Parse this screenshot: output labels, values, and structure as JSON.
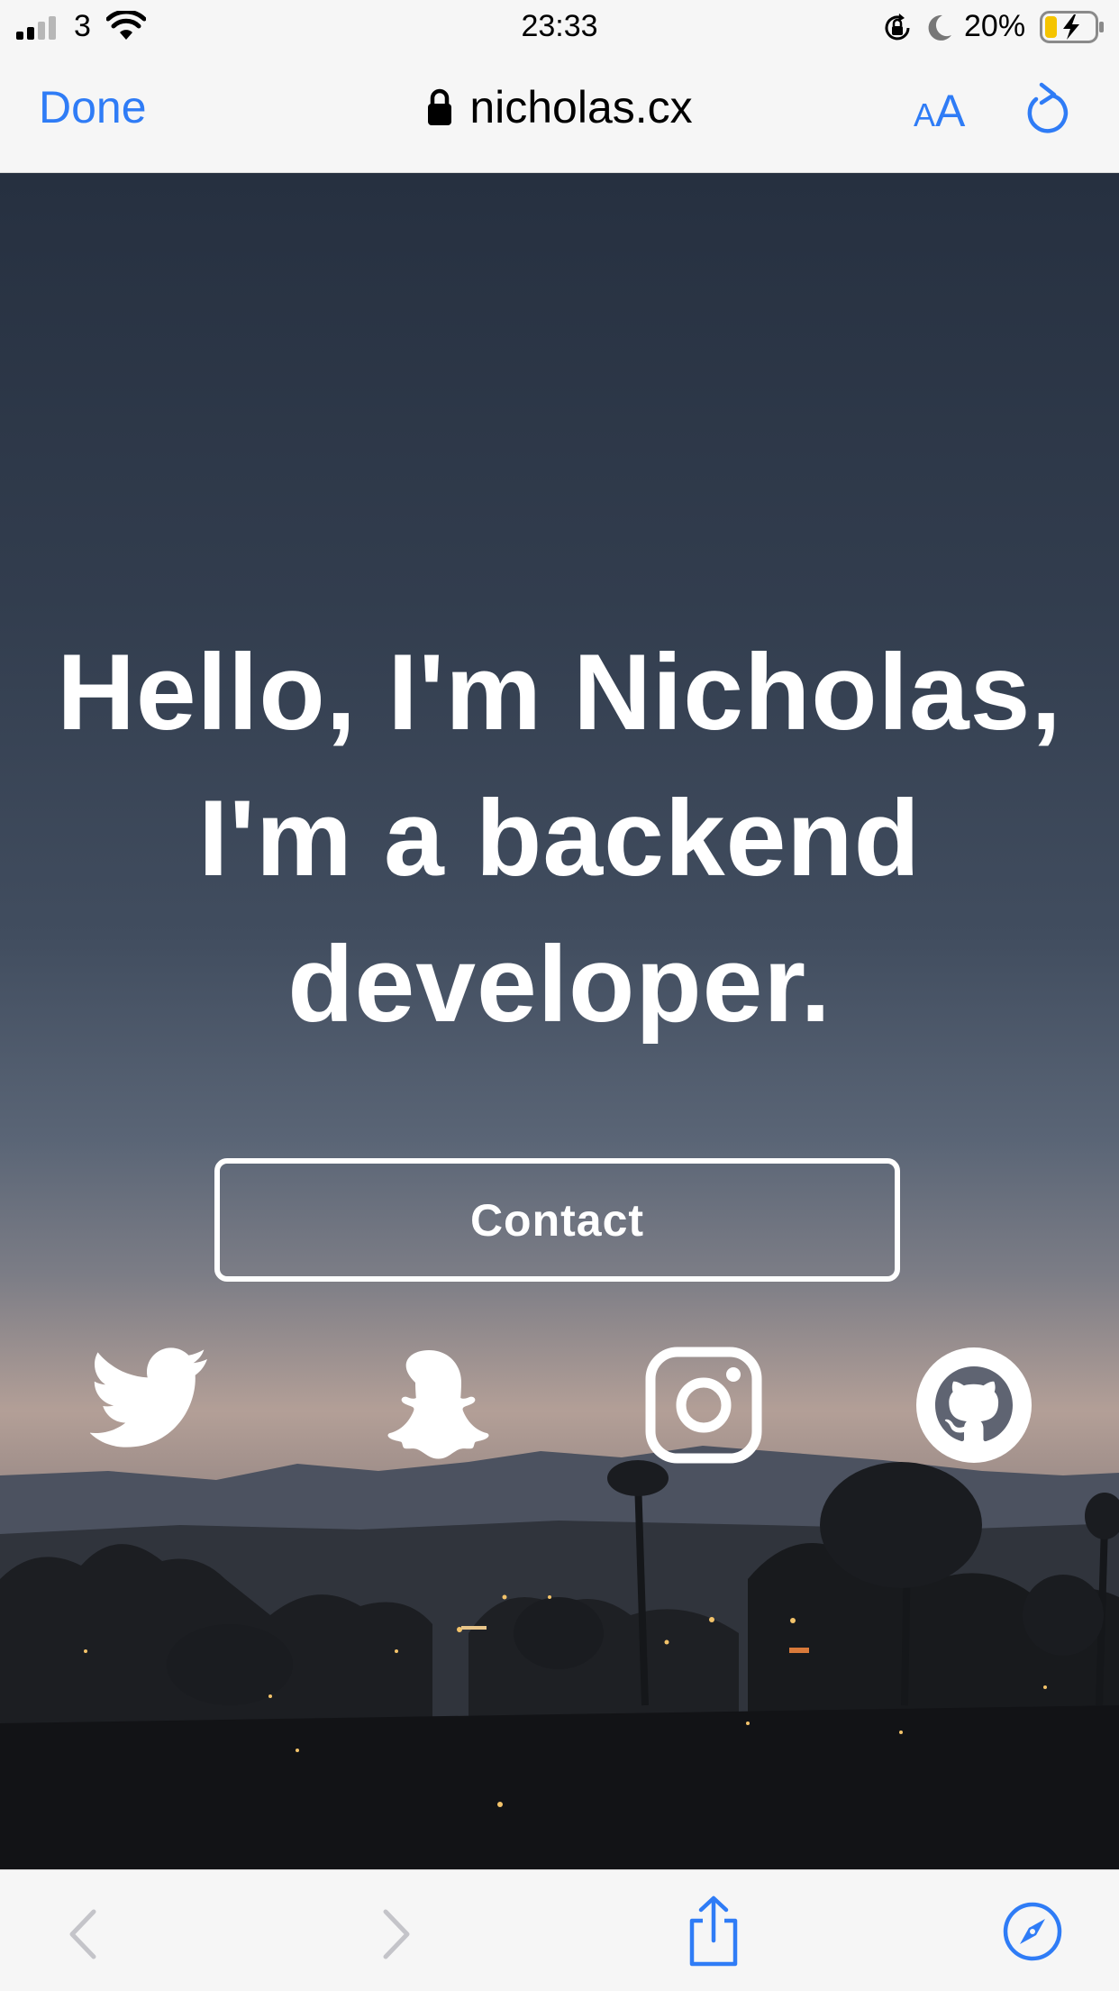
{
  "status_bar": {
    "carrier": "3",
    "time": "23:33",
    "battery_percent": "20%",
    "signal_bars": 2,
    "icons": [
      "signal-icon",
      "wifi-icon",
      "rotation-lock-icon",
      "moon-icon",
      "battery-charging-icon"
    ]
  },
  "nav": {
    "done_label": "Done",
    "url": "nicholas.cx",
    "text_size_label_small": "A",
    "text_size_label_large": "A",
    "icons": [
      "lock-icon",
      "reload-icon"
    ]
  },
  "page": {
    "headline": "Hello, I'm Nicholas, I'm a backend developer.",
    "contact_label": "Contact",
    "social_links": [
      "twitter-icon",
      "snapchat-icon",
      "instagram-icon",
      "github-icon"
    ]
  },
  "toolbar": {
    "icons": [
      "back-icon",
      "forward-icon",
      "share-icon",
      "compass-icon"
    ],
    "back_enabled": false,
    "forward_enabled": false
  },
  "colors": {
    "accent": "#2f7cf6",
    "bar_background": "#f6f6f6",
    "disabled": "#c4c4c9"
  }
}
